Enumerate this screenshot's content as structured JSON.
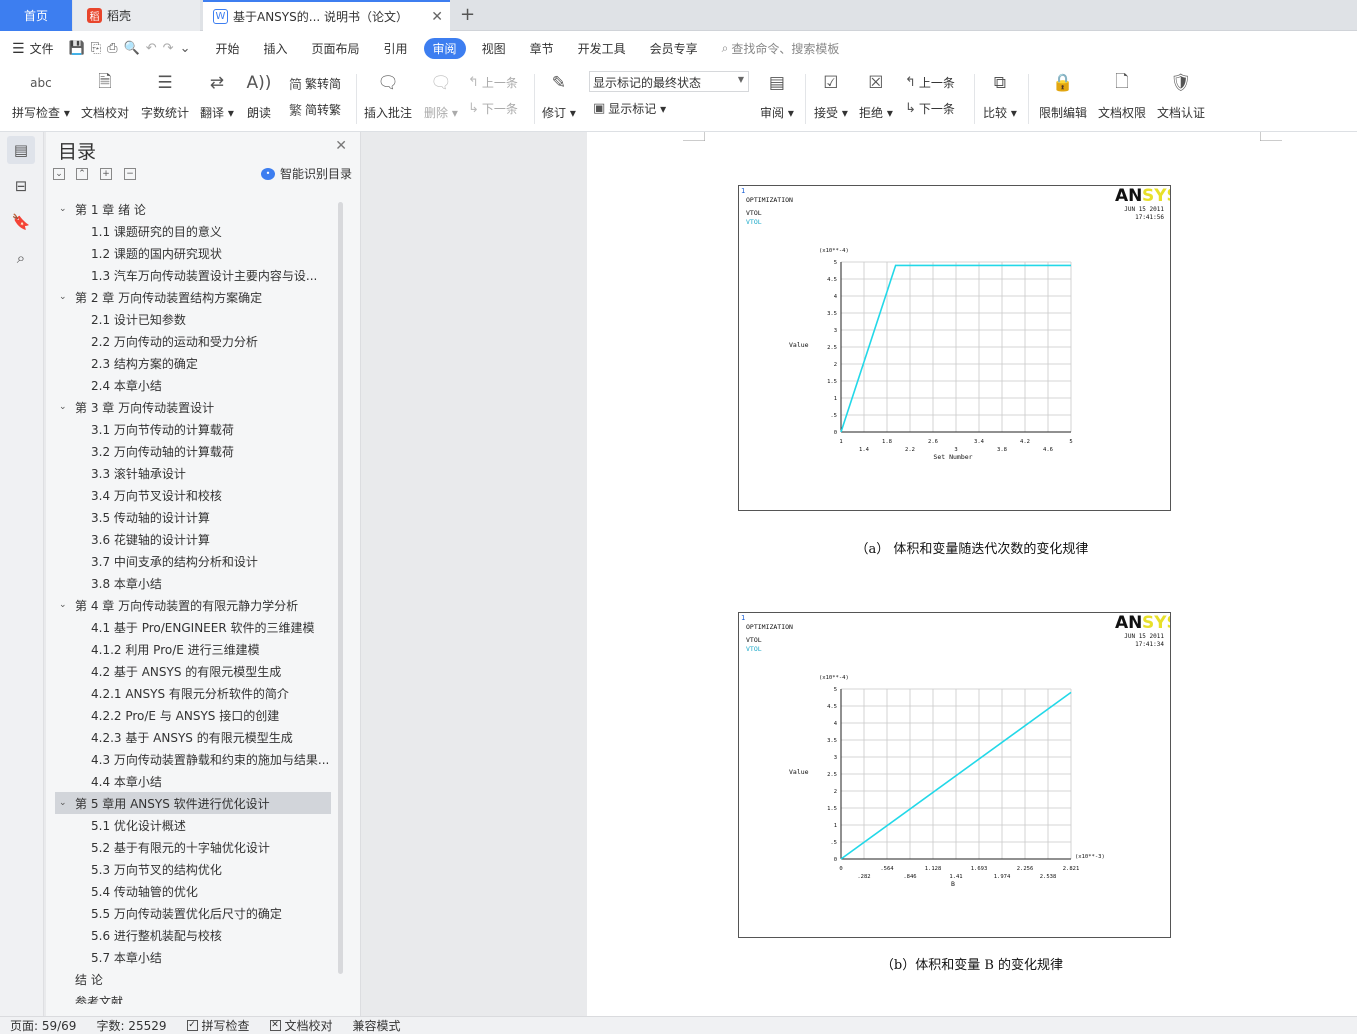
{
  "tabs": {
    "home": "首页",
    "daoke": "稻壳",
    "doc": "基于ANSYS的... 说明书（论文）",
    "new_tab": "+"
  },
  "menu": {
    "file": "文件",
    "items": [
      "开始",
      "插入",
      "页面布局",
      "引用",
      "审阅",
      "视图",
      "章节",
      "开发工具",
      "会员专享"
    ],
    "active": "审阅",
    "search_placeholder": "查找命令、搜索模板"
  },
  "ribbon": {
    "spell_check": "拼写检查",
    "doc_proof": "文档校对",
    "word_count": "字数统计",
    "translate": "翻译",
    "read_aloud": "朗读",
    "trad_to_simp": "繁转简",
    "simp_to_trad": "简转繁",
    "insert_comment": "插入批注",
    "delete": "删除",
    "prev": "上一条",
    "next": "下一条",
    "track_changes": "修订",
    "markup_select": "显示标记的最终状态",
    "show_markup": "显示标记",
    "review": "审阅",
    "accept": "接受",
    "reject": "拒绝",
    "prev2": "上一条",
    "next2": "下一条",
    "compare": "比较",
    "restrict_edit": "限制编辑",
    "doc_permission": "文档权限",
    "doc_cert": "文档认证"
  },
  "nav": {
    "title": "目录",
    "smart_toc": "智能识别目录",
    "toc": [
      {
        "level": 1,
        "text": "第 1 章  绪    论",
        "expanded": true
      },
      {
        "level": 2,
        "text": "1.1  课题研究的目的意义"
      },
      {
        "level": 2,
        "text": "1.2  课题的国内研究现状"
      },
      {
        "level": 2,
        "text": "1.3  汽车万向传动装置设计主要内容与设..."
      },
      {
        "level": 1,
        "text": "第 2 章  万向传动装置结构方案确定",
        "expanded": true
      },
      {
        "level": 2,
        "text": "2.1  设计已知参数"
      },
      {
        "level": 2,
        "text": "2.2  万向传动的运动和受力分析"
      },
      {
        "level": 2,
        "text": "2.3  结构方案的确定"
      },
      {
        "level": 2,
        "text": "2.4  本章小结"
      },
      {
        "level": 1,
        "text": "第 3 章  万向传动装置设计",
        "expanded": true
      },
      {
        "level": 2,
        "text": "3.1  万向节传动的计算载荷"
      },
      {
        "level": 2,
        "text": "3.2  万向传动轴的计算载荷"
      },
      {
        "level": 2,
        "text": "3.3  滚针轴承设计"
      },
      {
        "level": 2,
        "text": "3.4  万向节叉设计和校核"
      },
      {
        "level": 2,
        "text": "3.5  传动轴的设计计算"
      },
      {
        "level": 2,
        "text": "3.6  花键轴的设计计算"
      },
      {
        "level": 2,
        "text": "3.7  中间支承的结构分析和设计"
      },
      {
        "level": 2,
        "text": "3.8  本章小结"
      },
      {
        "level": 1,
        "text": "第  4  章    万向传动装置的有限元静力学分析",
        "expanded": true
      },
      {
        "level": 2,
        "text": "4.1  基于 Pro/ENGINEER 软件的三维建模"
      },
      {
        "level": 2,
        "text": "4.1.2 利用 Pro/E 进行三维建模"
      },
      {
        "level": 2,
        "text": "4.2  基于 ANSYS 的有限元模型生成"
      },
      {
        "level": 2,
        "text": "4.2.1 ANSYS 有限元分析软件的简介"
      },
      {
        "level": 2,
        "text": "4.2.2    Pro/E 与 ANSYS 接口的创建"
      },
      {
        "level": 2,
        "text": "4.2.3    基于 ANSYS 的有限元模型生成"
      },
      {
        "level": 2,
        "text": "4.3 万向传动装置静载和约束的施加与结果..."
      },
      {
        "level": 2,
        "text": "4.4  本章小结"
      },
      {
        "level": 1,
        "text": "第 5 章用 ANSYS 软件进行优化设计",
        "expanded": true,
        "selected": true
      },
      {
        "level": 2,
        "text": "5.1 优化设计概述"
      },
      {
        "level": 2,
        "text": "5.2    基于有限元的十字轴优化设计"
      },
      {
        "level": 2,
        "text": "5.3    万向节叉的结构优化"
      },
      {
        "level": 2,
        "text": "5.4    传动轴管的优化"
      },
      {
        "level": 2,
        "text": "5.5  万向传动装置优化后尺寸的确定"
      },
      {
        "level": 2,
        "text": "5.6  进行整机装配与校核"
      },
      {
        "level": 2,
        "text": "5.7    本章小结"
      },
      {
        "level": 3,
        "text": "结    论"
      },
      {
        "level": 3,
        "text": "参考文献"
      }
    ]
  },
  "figures": {
    "a": {
      "win": "1",
      "header": "OPTIMIZATION",
      "line2": "VTOL",
      "line3": "VTOL",
      "brand_dark": "AN",
      "brand_light": "SYS",
      "date": "JUN 15 2011",
      "time": "17:41:56",
      "caption": "（a）   体积和变量随迭代次数的变化规律"
    },
    "b": {
      "win": "1",
      "header": "OPTIMIZATION",
      "line2": "VTOL",
      "line3": "VTOL",
      "brand_dark": "AN",
      "brand_light": "SYS",
      "date": "JUN 15 2011",
      "time": "17:41:34",
      "caption": "（b）体积和变量 B 的变化规律"
    }
  },
  "chart_data": [
    {
      "type": "line",
      "xlabel": "Set Number",
      "ylabel": "Value",
      "y_multiplier": "(x10**-4)",
      "xlim": [
        1,
        5
      ],
      "ylim": [
        0,
        5
      ],
      "x_ticks_top": [
        "1",
        "1.8",
        "2.6",
        "3.4",
        "4.2",
        "5"
      ],
      "x_ticks_bottom": [
        "1.4",
        "2.2",
        "3",
        "3.8",
        "4.6"
      ],
      "y_ticks": [
        "0",
        ".5",
        "1",
        "1.5",
        "2",
        "2.5",
        "3",
        "3.5",
        "4",
        "4.5",
        "5"
      ],
      "grid": true,
      "color": "#22d8e8",
      "series": [
        {
          "x": [
            1,
            1.95,
            5
          ],
          "y": [
            0,
            4.9,
            4.9
          ]
        }
      ]
    },
    {
      "type": "line",
      "xlabel": "B",
      "ylabel": "Value",
      "y_multiplier": "(x10**-4)",
      "x_multiplier": "(x10**-3)",
      "xlim": [
        0,
        2.821
      ],
      "ylim": [
        0,
        5
      ],
      "x_ticks_top": [
        "0",
        ".564",
        "1.128",
        "1.693",
        "2.256",
        "2.821"
      ],
      "x_ticks_bottom": [
        ".282",
        ".846",
        "1.41",
        "1.974",
        "2.538"
      ],
      "y_ticks": [
        "0",
        ".5",
        "1",
        "1.5",
        "2",
        "2.5",
        "3",
        "3.5",
        "4",
        "4.5",
        "5"
      ],
      "grid": true,
      "color": "#22d8e8",
      "series": [
        {
          "x": [
            0,
            2.821
          ],
          "y": [
            0,
            4.9
          ]
        }
      ]
    }
  ],
  "status": {
    "page": "页面: 59/69",
    "words": "字数: 25529",
    "spell": "拼写检查",
    "proof": "文档校对",
    "compat": "兼容模式"
  }
}
